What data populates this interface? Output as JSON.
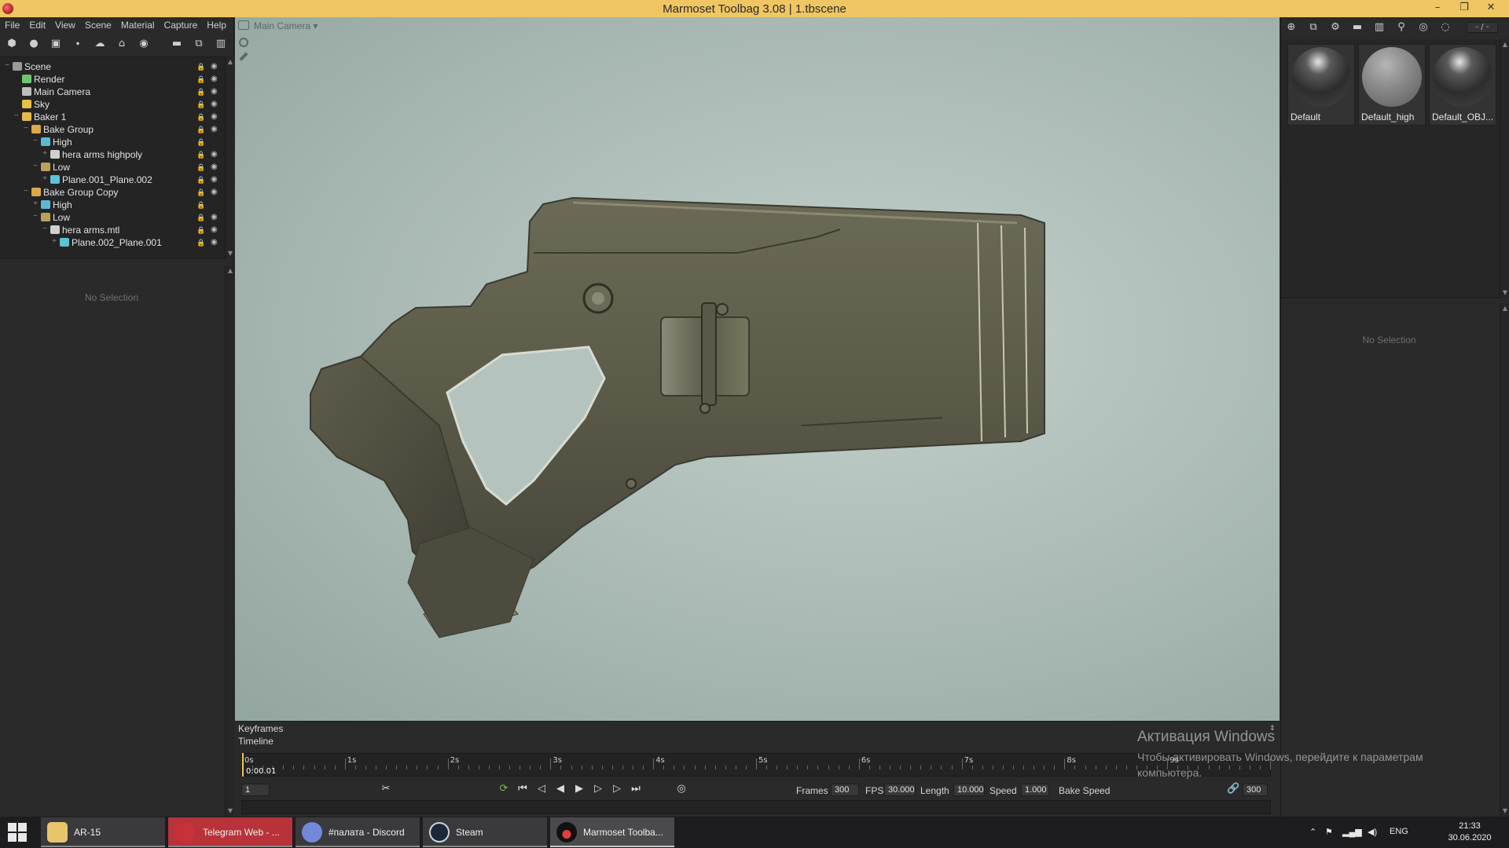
{
  "window": {
    "title": "Marmoset Toolbag 3.08  |  1.tbscene",
    "minimize": "–",
    "restore": "❐",
    "close": "✕"
  },
  "menu": [
    "File",
    "Edit",
    "View",
    "Scene",
    "Material",
    "Capture",
    "Help"
  ],
  "scene_tree": [
    {
      "label": "Scene",
      "depth": 0,
      "expander": "−",
      "icon": "scene-icon",
      "color": "#9a9a9a"
    },
    {
      "label": "Render",
      "depth": 1,
      "expander": "",
      "icon": "render-icon",
      "color": "#6fc56f"
    },
    {
      "label": "Main Camera",
      "depth": 1,
      "expander": "",
      "icon": "camera-icon",
      "color": "#bdbdbd"
    },
    {
      "label": "Sky",
      "depth": 1,
      "expander": "",
      "icon": "sky-icon",
      "color": "#e8c04a"
    },
    {
      "label": "Baker 1",
      "depth": 1,
      "expander": "−",
      "icon": "baker-icon",
      "color": "#e8b94a"
    },
    {
      "label": "Bake Group",
      "depth": 2,
      "expander": "−",
      "icon": "folder-icon",
      "color": "#d9a94a"
    },
    {
      "label": "High",
      "depth": 3,
      "expander": "−",
      "icon": "high-icon",
      "color": "#5db8d6"
    },
    {
      "label": "hera arms highpoly",
      "depth": 4,
      "expander": "+",
      "icon": "material-icon",
      "color": "#cfcfcf"
    },
    {
      "label": "Low",
      "depth": 3,
      "expander": "−",
      "icon": "low-icon",
      "color": "#b8a25a"
    },
    {
      "label": "Plane.001_Plane.002",
      "depth": 4,
      "expander": "+",
      "icon": "mesh-icon",
      "color": "#5dc3d6"
    },
    {
      "label": "Bake Group Copy",
      "depth": 2,
      "expander": "−",
      "icon": "folder-icon",
      "color": "#d9a94a"
    },
    {
      "label": "High",
      "depth": 3,
      "expander": "+",
      "icon": "high-icon",
      "color": "#5db8d6"
    },
    {
      "label": "Low",
      "depth": 3,
      "expander": "−",
      "icon": "low-icon",
      "color": "#b8a25a"
    },
    {
      "label": "hera arms.mtl",
      "depth": 4,
      "expander": "−",
      "icon": "material-icon",
      "color": "#cfcfcf"
    },
    {
      "label": "Plane.002_Plane.001",
      "depth": 5,
      "expander": "+",
      "icon": "mesh-icon",
      "color": "#5dc3d6"
    }
  ],
  "left_props": {
    "no_selection": "No Selection"
  },
  "viewport": {
    "camera_label": "Main Camera",
    "camera_dropdown": "▾"
  },
  "timeline": {
    "keyframes_label": "Keyframes",
    "timeline_label": "Timeline",
    "ticks": [
      "0s",
      "1s",
      "2s",
      "3s",
      "4s",
      "5s",
      "6s",
      "7s",
      "8s",
      "9s"
    ],
    "time_readout": "0:00.01",
    "current_frame": "1",
    "frames_label": "Frames",
    "frames": "300",
    "fps_label": "FPS",
    "fps": "30.000",
    "length_label": "Length",
    "length": "10.000",
    "speed_label": "Speed",
    "speed": "1.000",
    "bake_speed_label": "Bake Speed",
    "end_frame": "300"
  },
  "materials": [
    {
      "name": "Default",
      "style": "spec-dark"
    },
    {
      "name": "Default_high",
      "style": "matte-grey"
    },
    {
      "name": "Default_OBJ...",
      "style": "spec-dark"
    }
  ],
  "right_toolbar": {
    "page": "- / -"
  },
  "right_props": {
    "no_selection": "No Selection"
  },
  "watermark": {
    "line1": "Активация Windows",
    "line2": "Чтобы активировать Windows, перейдите к параметрам",
    "line3": "компьютера."
  },
  "taskbar": {
    "tasks": [
      {
        "label": "AR-15",
        "icon": "folder-icon",
        "color": "#e8c56a"
      },
      {
        "label": "Telegram Web - ...",
        "icon": "telegram-icon",
        "color": "#c8303a"
      },
      {
        "label": "#палата - Discord",
        "icon": "discord-icon",
        "color": "#7289da"
      },
      {
        "label": "Steam",
        "icon": "steam-icon",
        "color": "#1b2838"
      },
      {
        "label": "Marmoset Toolba...",
        "icon": "marmoset-icon",
        "color": "#222"
      }
    ],
    "language": "ENG",
    "time": "21:33",
    "date": "30.06.2020"
  }
}
